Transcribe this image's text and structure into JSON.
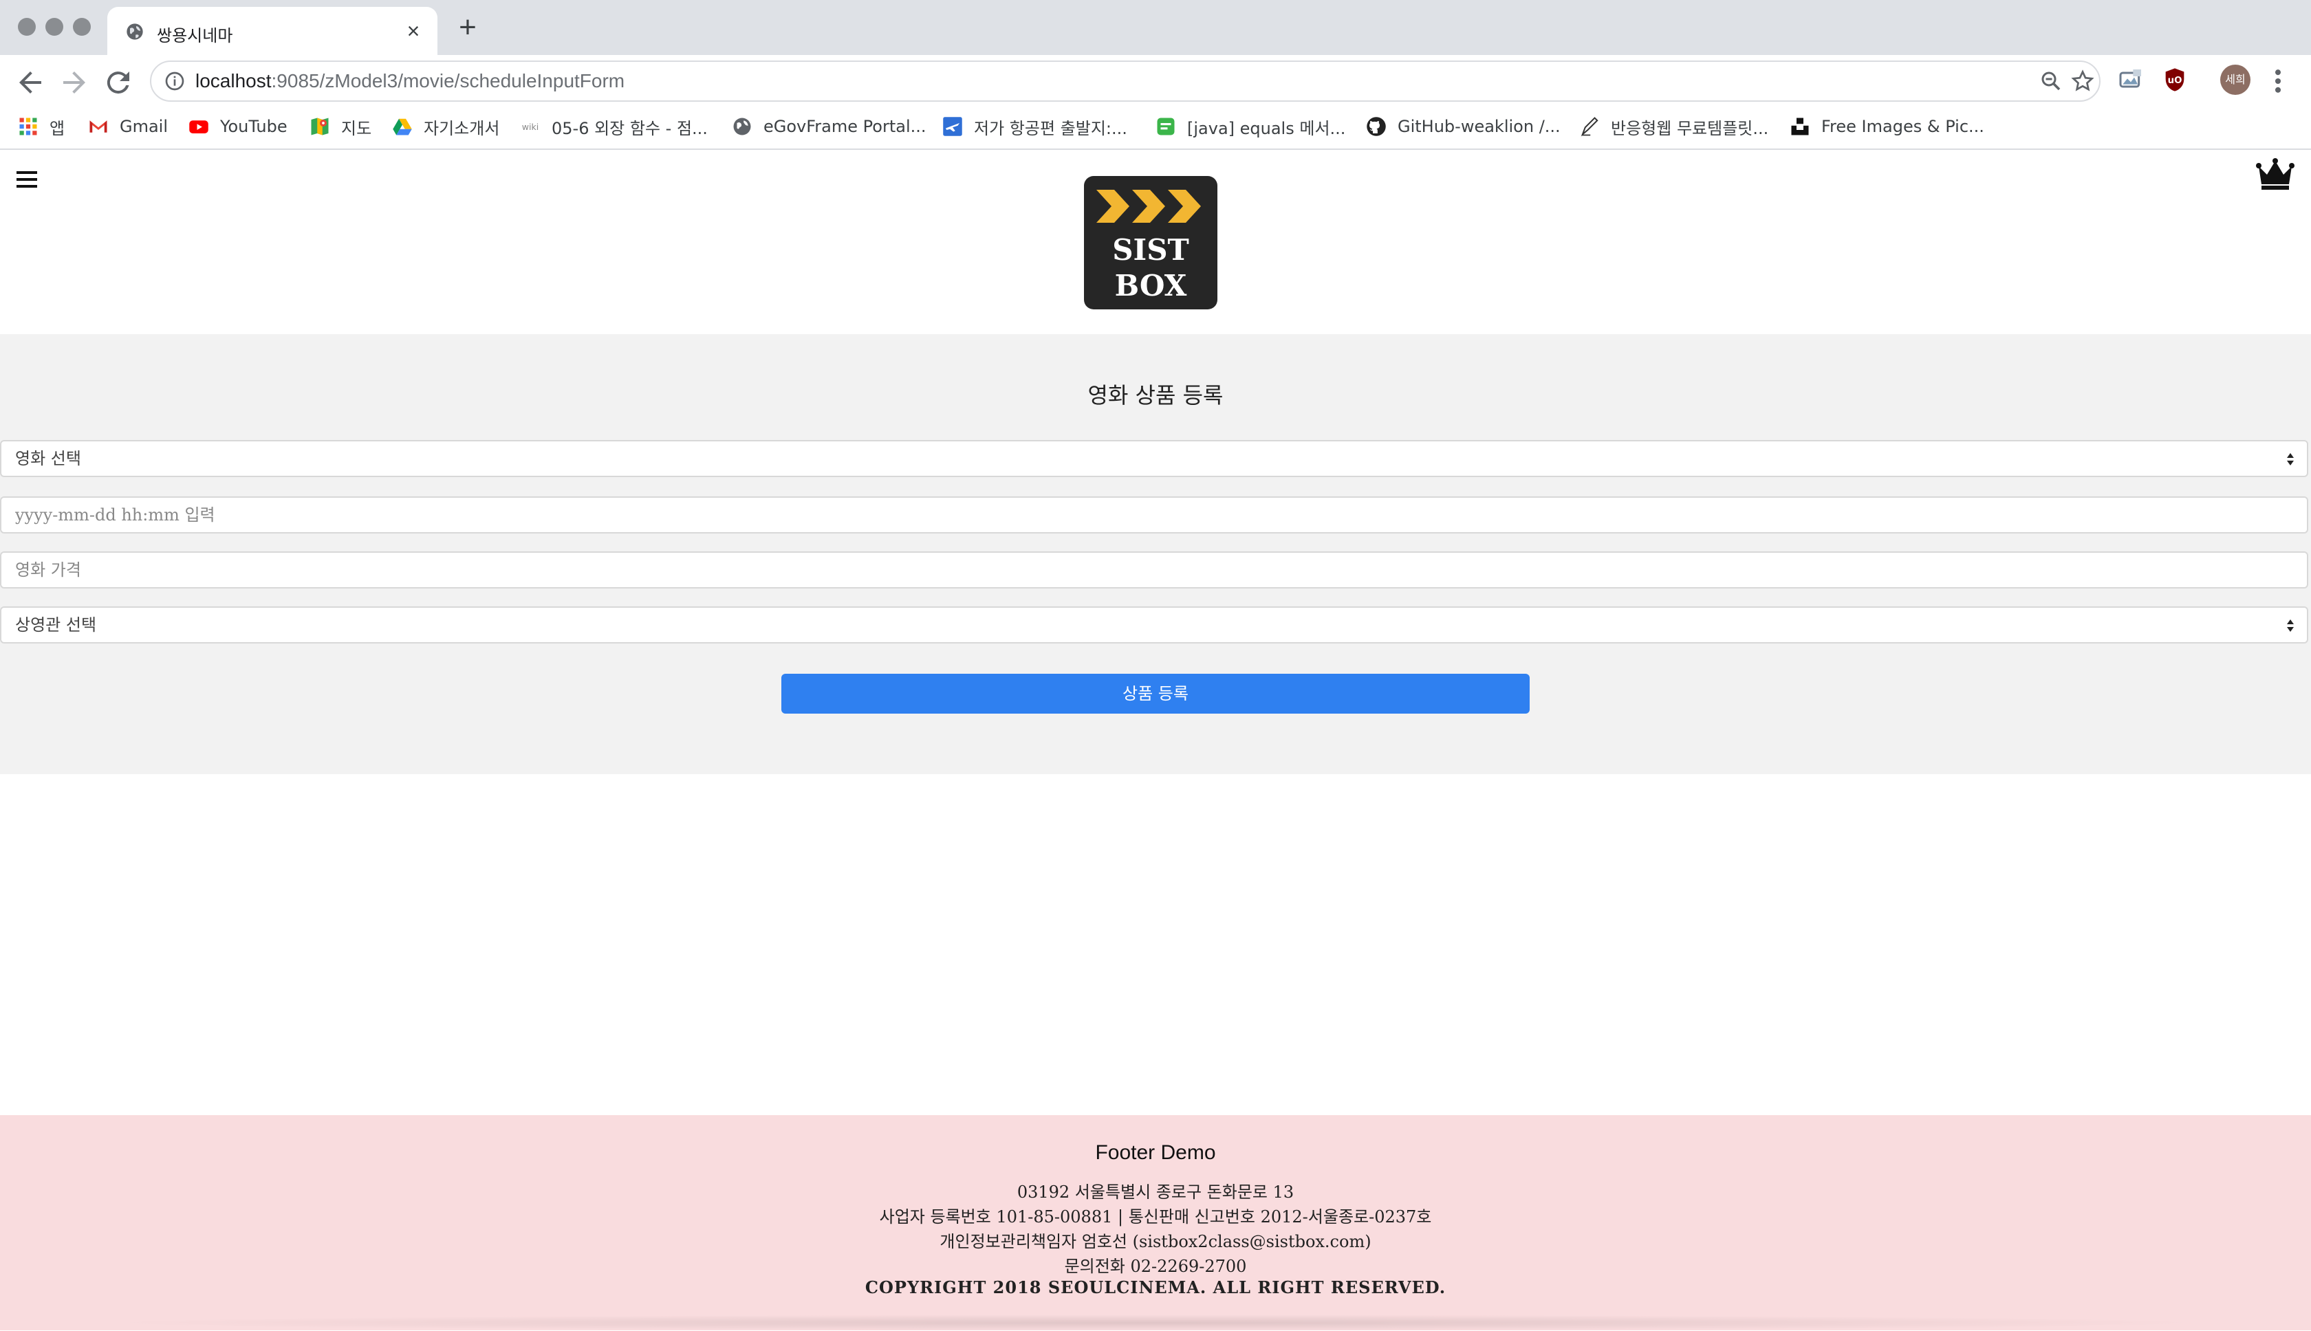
{
  "browser": {
    "tab": {
      "title": "쌍용시네마"
    },
    "url": {
      "host": "localhost",
      "path": ":9085/zModel3/movie/scheduleInputForm"
    },
    "profile_initials": "세희",
    "bookmarks": [
      {
        "label": "앱",
        "icon": "apps-grid-icon"
      },
      {
        "label": "Gmail",
        "icon": "gmail-icon"
      },
      {
        "label": "YouTube",
        "icon": "youtube-icon"
      },
      {
        "label": "지도",
        "icon": "maps-icon"
      },
      {
        "label": "자기소개서",
        "icon": "drive-icon"
      },
      {
        "label": "05-6 외장 함수 - 점...",
        "icon": "wikidocs-icon"
      },
      {
        "label": "eGovFrame Portal...",
        "icon": "globe-icon"
      },
      {
        "label": "저가 항공편 출발지:...",
        "icon": "flight-icon"
      },
      {
        "label": "[java] equals 메서...",
        "icon": "blog-icon"
      },
      {
        "label": "GitHub-weaklion /...",
        "icon": "github-icon"
      },
      {
        "label": "반응형웹 무료템플릿...",
        "icon": "pen-icon"
      },
      {
        "label": "Free Images & Pic...",
        "icon": "unsplash-icon"
      }
    ]
  },
  "header": {
    "logo_lines": [
      "SIST",
      "BOX"
    ],
    "logo_colors": {
      "bg": "#262626",
      "chevron": "#f2b632"
    }
  },
  "form": {
    "title": "영화 상품 등록",
    "movie_select": {
      "selected": "영화 선택"
    },
    "datetime_input": {
      "placeholder": "yyyy-mm-dd hh:mm 입력"
    },
    "price_input": {
      "placeholder": "영화 가격"
    },
    "theater_select": {
      "selected": "상영관 선택"
    },
    "submit_label": "상품 등록",
    "accent_color": "#2f80f0"
  },
  "footer": {
    "title": "Footer Demo",
    "address": "03192 서울특별시 종로구 돈화문로 13",
    "business": "사업자 등록번호 101-85-00881 | 통신판매 신고번호 2012-서울종로-0237호",
    "privacy": "개인정보관리책임자 엄호선 (sistbox2class@sistbox.com)",
    "phone": "문의전화 02-2269-2700",
    "copyright": "COPYRIGHT 2018 SEOULCINEMA. ALL RIGHT RESERVED.",
    "bg_color": "#f9dcde"
  }
}
